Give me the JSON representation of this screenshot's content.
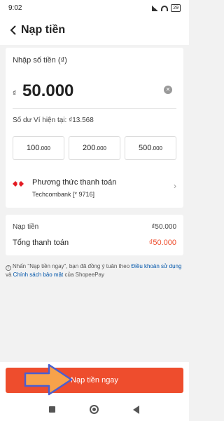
{
  "status": {
    "time": "9:02",
    "battery": "29"
  },
  "header": {
    "title": "Nạp tiền"
  },
  "amount": {
    "label": "Nhập số tiền (₫)",
    "currency": "₫",
    "value": "50.000"
  },
  "balance": "Số dư Ví hiện tại: ₫13.568",
  "quick_amounts": [
    {
      "main": "100",
      "sub": ".000"
    },
    {
      "main": "200",
      "sub": ".000"
    },
    {
      "main": "500",
      "sub": ".000"
    }
  ],
  "payment": {
    "title": "Phương thức thanh toán",
    "bank": "Techcombank [* 9716]"
  },
  "summary": {
    "topup_label": "Nạp tiền",
    "topup_value": "₫50.000",
    "total_label": "Tổng thanh toán",
    "total_value": "₫50.000"
  },
  "notice": {
    "pre": "Nhấn \"Nạp tiền ngay\", bạn đã đồng ý tuân theo ",
    "terms": "Điều khoản sử dụng",
    "mid": " và ",
    "privacy": "Chính sách bảo mật",
    "post": " của ShopeePay"
  },
  "cta_label": "Nạp tiền ngay",
  "colors": {
    "accent": "#ee4d2d",
    "arrow": "#f7a24a"
  }
}
